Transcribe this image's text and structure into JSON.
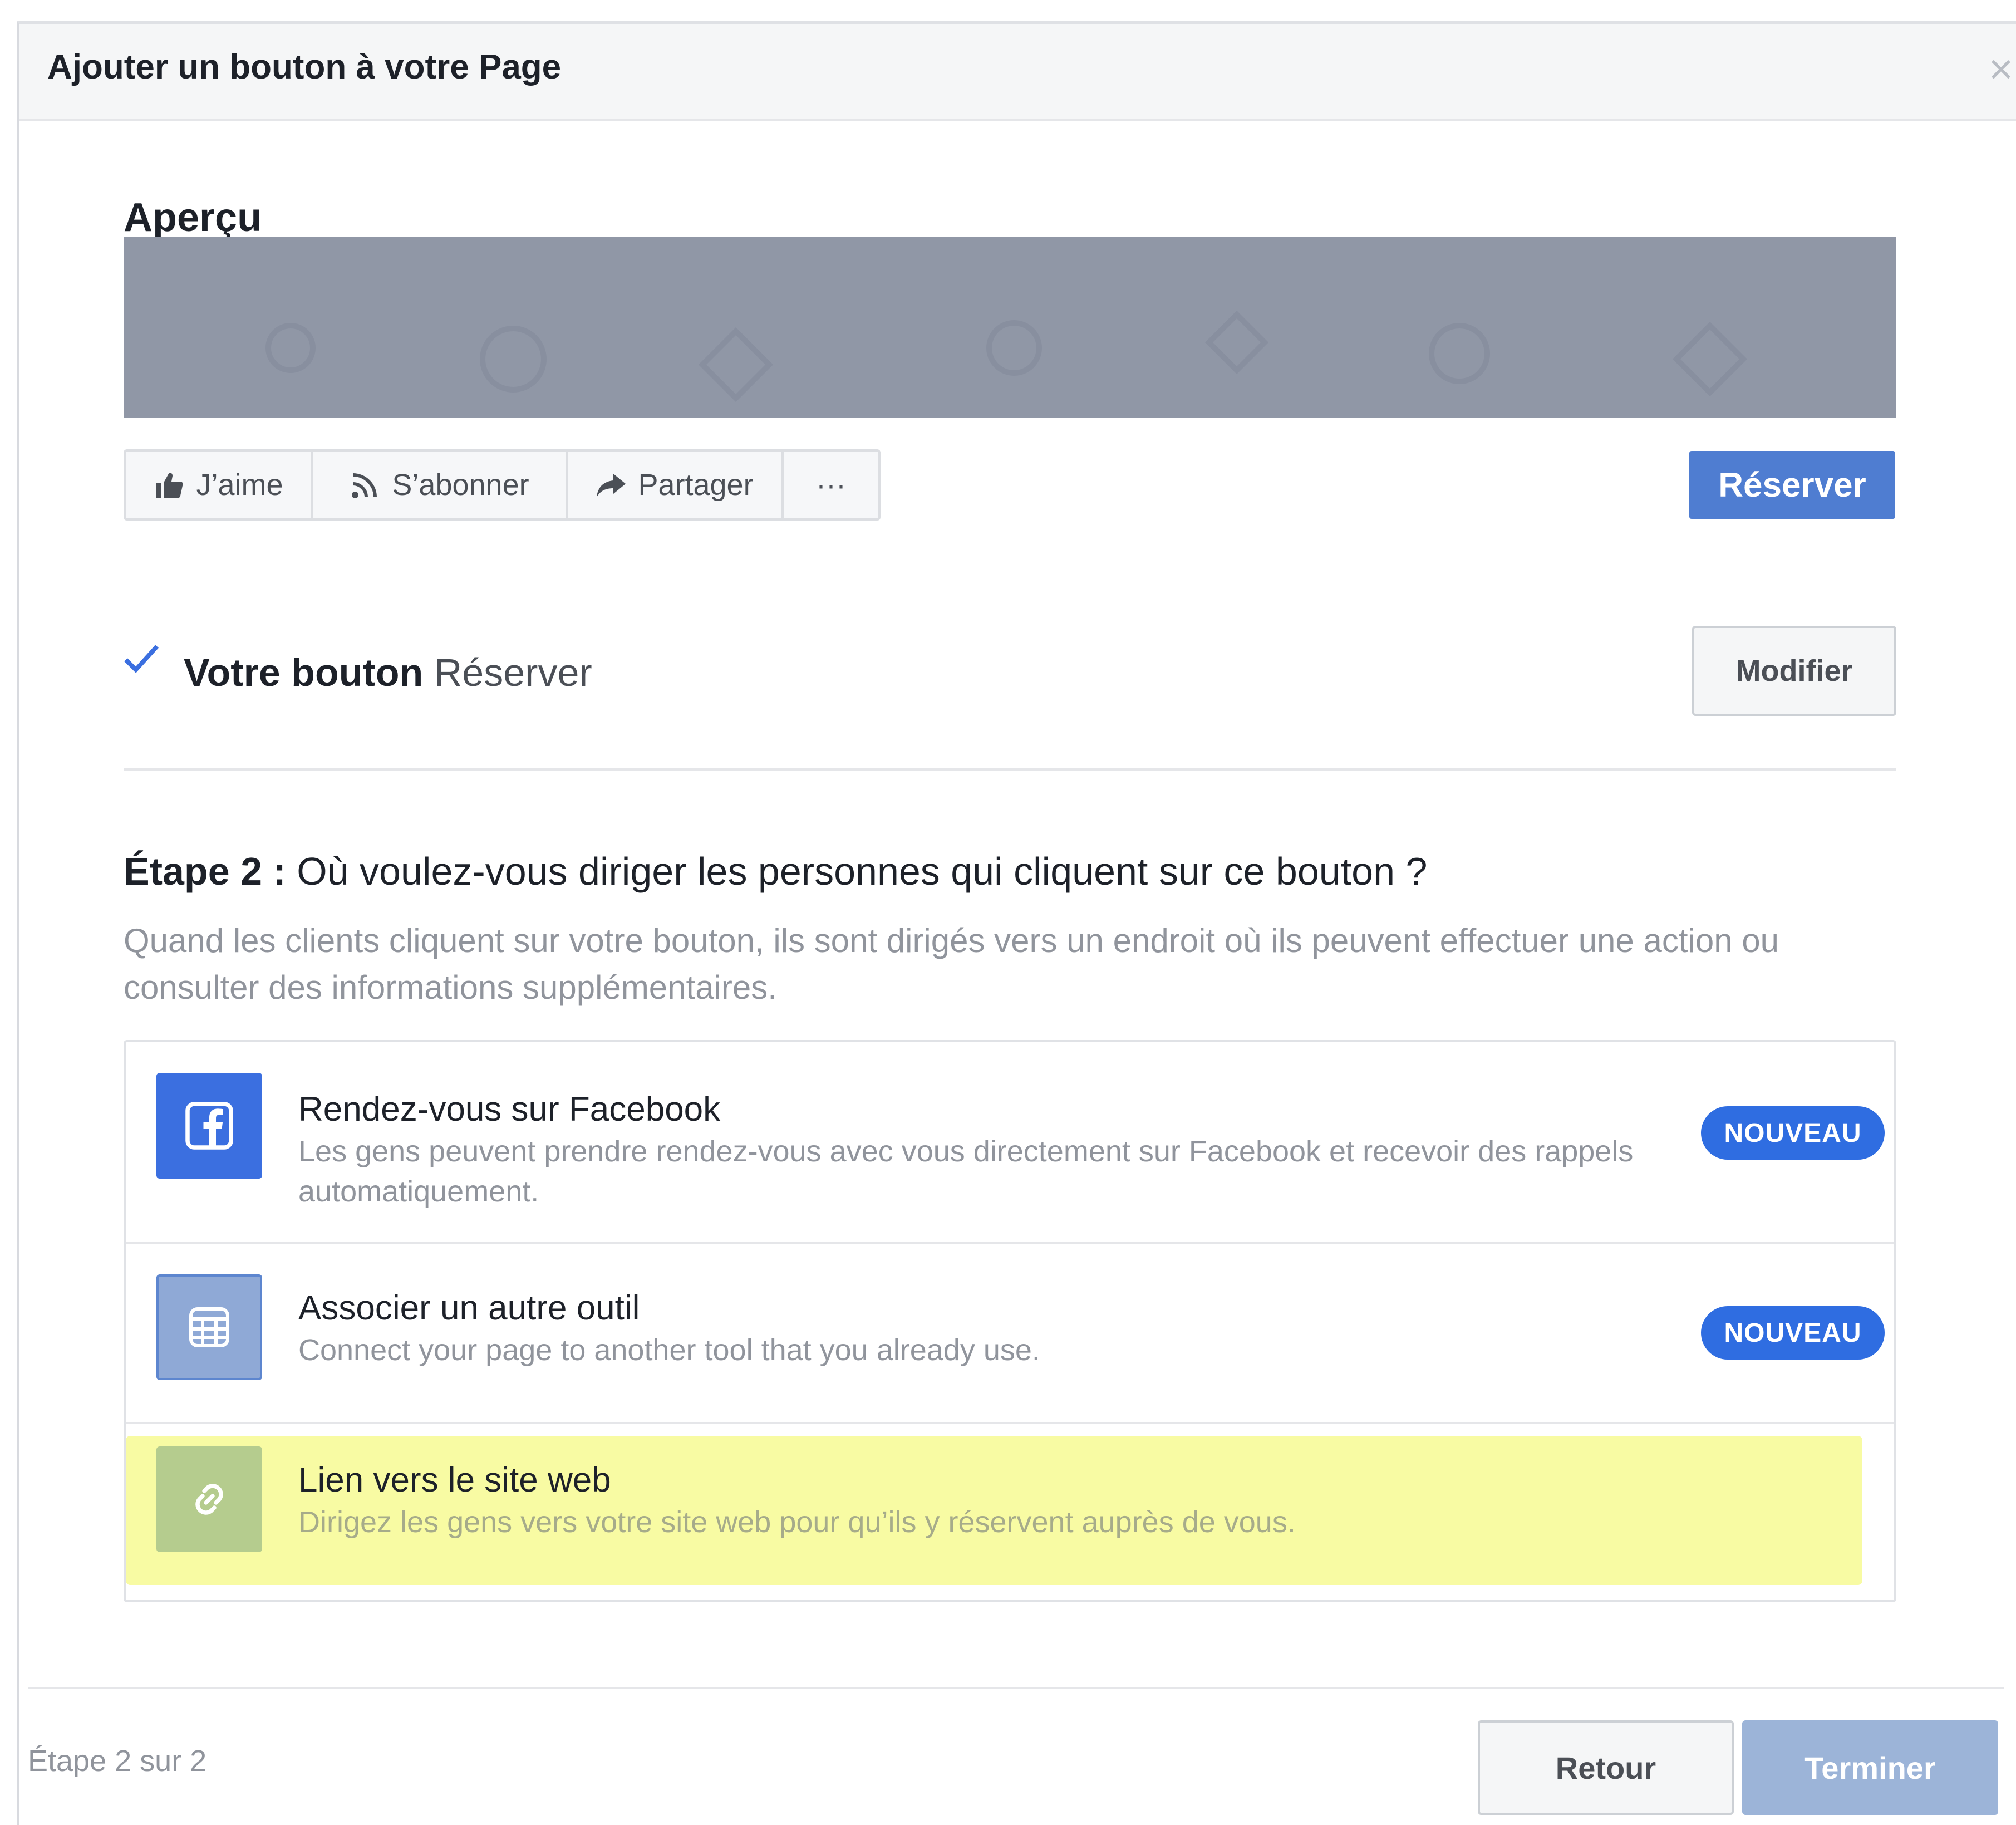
{
  "dialog": {
    "title": "Ajouter un bouton à votre Page",
    "close_icon": "close-icon"
  },
  "preview": {
    "heading": "Aperçu",
    "actions": [
      {
        "label": "J’aime",
        "icon": "thumbs-up-icon"
      },
      {
        "label": "S’abonner",
        "icon": "rss-icon"
      },
      {
        "label": "Partager",
        "icon": "share-arrow-icon"
      },
      {
        "label": "···",
        "icon": "more-icon"
      }
    ],
    "cta_label": "Réserver"
  },
  "your_button": {
    "label": "Votre bouton",
    "value": "Réserver",
    "modify_label": "Modifier"
  },
  "step": {
    "prefix": "Étape 2 :",
    "question": "Où voulez-vous diriger les personnes qui cliquent sur ce bouton ?",
    "description": "Quand les clients cliquent sur votre bouton, ils sont dirigés vers un endroit où ils peuvent effectuer une action ou consulter des informations supplémentaires."
  },
  "options": [
    {
      "title": "Rendez-vous sur Facebook",
      "description": "Les gens peuvent prendre rendez-vous avec vous directement sur Facebook et recevoir des rappels automatiquement.",
      "badge": "NOUVEAU",
      "icon": "facebook-icon",
      "icon_color": "#3b6fe0"
    },
    {
      "title": "Associer un autre outil",
      "description": "Connect your page to another tool that you already use.",
      "badge": "NOUVEAU",
      "icon": "calendar-icon",
      "icon_color": "#8fa9d6"
    },
    {
      "title": "Lien vers le site web",
      "description": "Dirigez les gens vers votre site web pour qu’ils y réservent auprès de vous.",
      "icon": "link-icon",
      "icon_color": "#b5cc8e",
      "highlighted": true
    }
  ],
  "footer": {
    "step_text": "Étape 2 sur 2",
    "back_label": "Retour",
    "finish_label": "Terminer"
  },
  "colors": {
    "primary_button": "#4f7dd1",
    "badge": "#2f6de1",
    "highlight": "#f8fba3",
    "disabled_button": "#9cb4d8"
  }
}
